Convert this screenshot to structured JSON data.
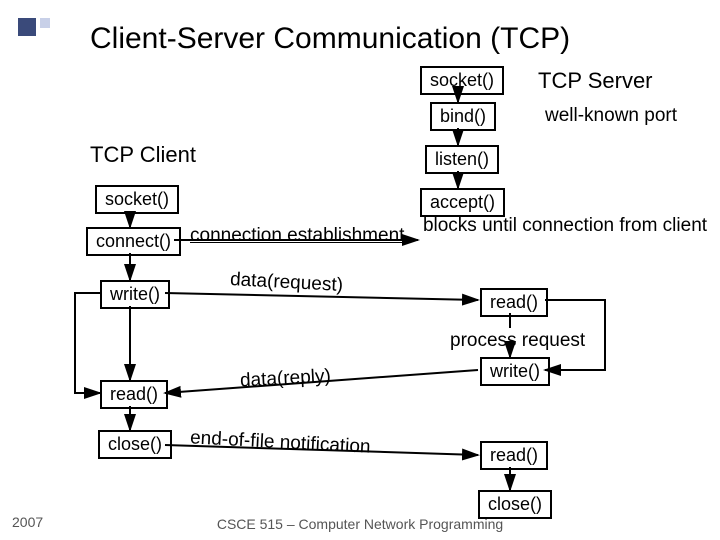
{
  "title": "Client-Server Communication (TCP)",
  "server_label": "TCP Server",
  "client_label": "TCP Client",
  "well_known_port": "well-known port",
  "server": {
    "socket": "socket()",
    "bind": "bind()",
    "listen": "listen()",
    "accept": "accept()",
    "accept_note": "blocks until connection from client",
    "read1": "read()",
    "process": "process request",
    "write": "write()",
    "read2": "read()",
    "close": "close()"
  },
  "client": {
    "socket": "socket()",
    "connect": "connect()",
    "write": "write()",
    "read": "read()",
    "close": "close()"
  },
  "msgs": {
    "conn_est": "connection establishment",
    "data_req": "data(request)",
    "data_reply": "data(reply)",
    "eof": "end-of-file notification"
  },
  "footer": {
    "year": "2007",
    "course": "CSCE 515 – Computer Network Programming"
  }
}
